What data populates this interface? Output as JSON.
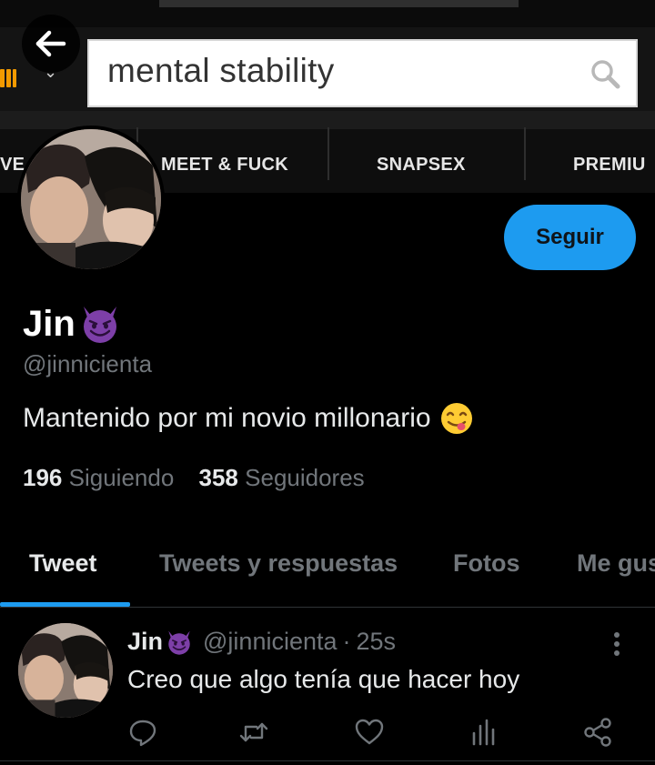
{
  "banner": {
    "search": {
      "value": "mental stability"
    },
    "nav": [
      "VE",
      "MEET & FUCK",
      "SNAPSEX",
      "PREMIU"
    ]
  },
  "profile": {
    "name": "Jin",
    "name_emoji": "smiling-devil",
    "handle": "@jinnicienta",
    "bio": "Mantenido por mi novio millonario",
    "bio_emoji": "face-savoring-food",
    "following_count": "196",
    "following_label": "Siguiendo",
    "followers_count": "358",
    "followers_label": "Seguidores",
    "follow_label": "Seguir"
  },
  "tabs": [
    {
      "label": "Tweet",
      "active": true
    },
    {
      "label": "Tweets y respuestas",
      "active": false
    },
    {
      "label": "Fotos",
      "active": false
    },
    {
      "label": "Me gus",
      "active": false
    }
  ],
  "tweet": {
    "name": "Jin",
    "handle": "@jinnicienta",
    "separator": "·",
    "time": "25s",
    "text": "Creo que algo tenía que hacer hoy",
    "actions": [
      "reply-icon",
      "retweet-icon",
      "like-icon",
      "analytics-icon",
      "share-icon"
    ]
  },
  "colors": {
    "accent": "#1d9bf0",
    "background": "#000000",
    "secondary_text": "#71767b",
    "emoji_devil": "#7d3fa8",
    "logo_orange": "#f39a00"
  }
}
